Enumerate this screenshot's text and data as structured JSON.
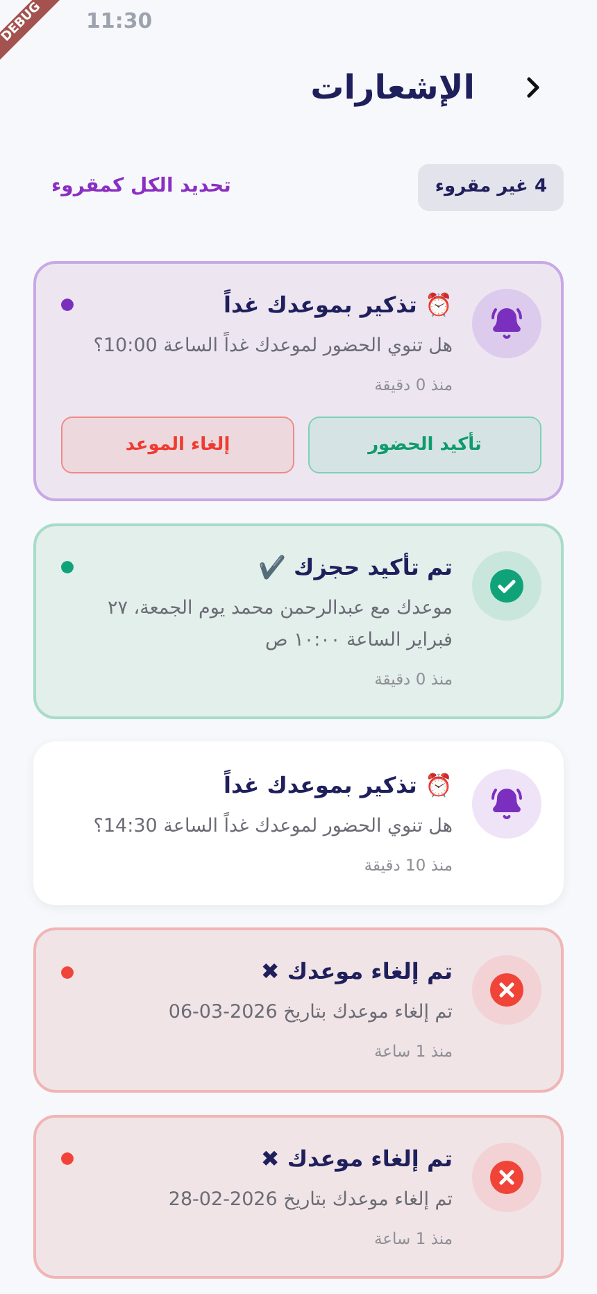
{
  "status_bar": {
    "time": "11:30"
  },
  "debug_banner": "DEBUG",
  "header": {
    "title": "الإشعارات"
  },
  "toolbar": {
    "unread_badge": "4 غير مقروء",
    "mark_all_link": "تحديد الكل كمقروء"
  },
  "notifications": [
    {
      "kind": "reminder",
      "unread": true,
      "title": "⏰ تذكير بموعدك غداً",
      "body": "هل تنوي الحضور لموعدك غداً الساعة 10:00؟",
      "time": "منذ 0 دقيقة",
      "actions": [
        {
          "kind": "confirm",
          "label": "تأكيد الحضور"
        },
        {
          "kind": "cancel",
          "label": "إلغاء الموعد"
        }
      ]
    },
    {
      "kind": "confirmed",
      "unread": true,
      "title": "تم تأكيد حجزك ✔️",
      "body": "موعدك مع عبدالرحمن محمد يوم الجمعة، ٢٧ فبراير الساعة ١٠:٠٠ ص",
      "time": "منذ 0 دقيقة"
    },
    {
      "kind": "reminder",
      "unread": false,
      "title": "⏰ تذكير بموعدك غداً",
      "body": "هل تنوي الحضور لموعدك غداً الساعة 14:30؟",
      "time": "منذ 10 دقيقة"
    },
    {
      "kind": "cancelled",
      "unread": true,
      "title": "تم إلغاء موعدك ✖",
      "body": "تم إلغاء موعدك بتاريخ 2026-03-06",
      "time": "منذ 1 ساعة"
    },
    {
      "kind": "cancelled",
      "unread": true,
      "title": "تم إلغاء موعدك ✖",
      "body": "تم إلغاء موعدك بتاريخ 2026-02-28",
      "time": "منذ 1 ساعة"
    }
  ]
}
